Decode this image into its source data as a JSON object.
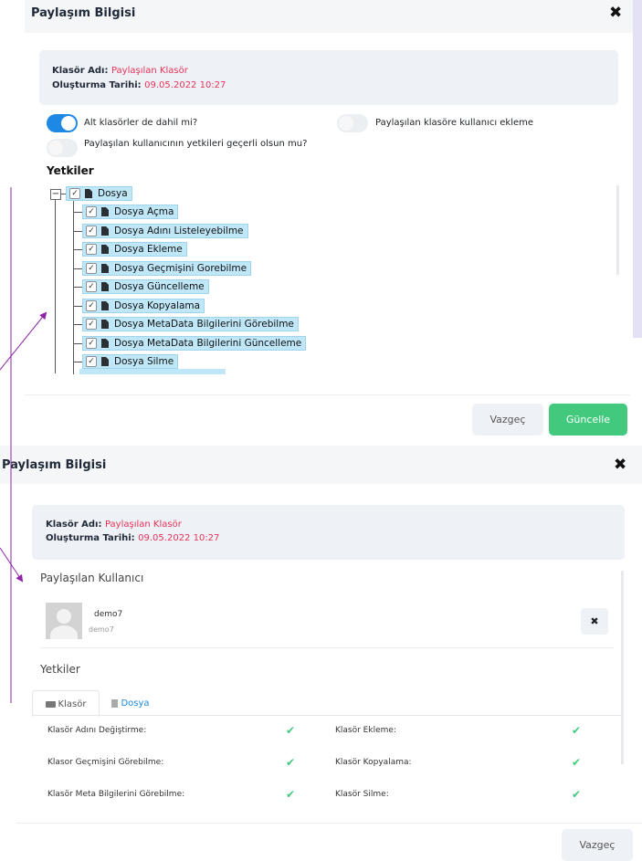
{
  "modal1": {
    "title": "Paylaşım Bilgisi",
    "close": "✖",
    "folder_name_label": "Klasör Adı:",
    "folder_name": "Paylaşılan Klasör",
    "created_label": "Oluşturma Tarihi:",
    "created": "09.05.2022 10:27",
    "toggles": [
      {
        "label": "Alt klasörler de dahil mi?",
        "on": true
      },
      {
        "label": "Paylaşılan klasöre kullanıcı ekleme",
        "on": false
      },
      {
        "label": "Paylaşılan kullanıcının yetkileri geçerli olsun mu?",
        "on": false
      }
    ],
    "section": "Yetkiler",
    "tree_root": "Dosya",
    "tree_items": [
      "Dosya Açma",
      "Dosya Adını Listeleyebilme",
      "Dosya Ekleme",
      "Dosya Geçmişini Gorebilme",
      "Dosya Güncelleme",
      "Dosya Kopyalama",
      "Dosya MetaData Bilgilerini Görebilme",
      "Dosya MetaData Bilgilerini Güncelleme",
      "Dosya Silme"
    ],
    "cancel": "Vazgeç",
    "update": "Güncelle"
  },
  "modal2": {
    "title": "Paylaşım Bilgisi",
    "close": "✖",
    "folder_name_label": "Klasör Adı:",
    "folder_name": "Paylaşılan Klasör",
    "created_label": "Oluşturma Tarihi:",
    "created": "09.05.2022 10:27",
    "shared_users_title": "Paylaşılan Kullanıcı",
    "user_name": "demo7",
    "user_sub": "demo7",
    "remove": "✖",
    "perm_title": "Yetkiler",
    "tabs": [
      "Klasör",
      "Dosya"
    ],
    "perms": [
      {
        "left": "Klasör Adını Değiştirme:",
        "right": "Klasör Ekleme:"
      },
      {
        "left": "Klasor Geçmişini Görebilme:",
        "right": "Klasör Kopyalama:"
      },
      {
        "left": "Klasör Meta Bilgilerini Görebilme:",
        "right": "Klasör Silme:"
      }
    ],
    "check": "✔",
    "cancel": "Vazgeç"
  },
  "colors": {
    "accent": "#1e88e5",
    "highlight": "#e8335a",
    "success": "#43c97e",
    "annotation": "#8e24aa"
  }
}
